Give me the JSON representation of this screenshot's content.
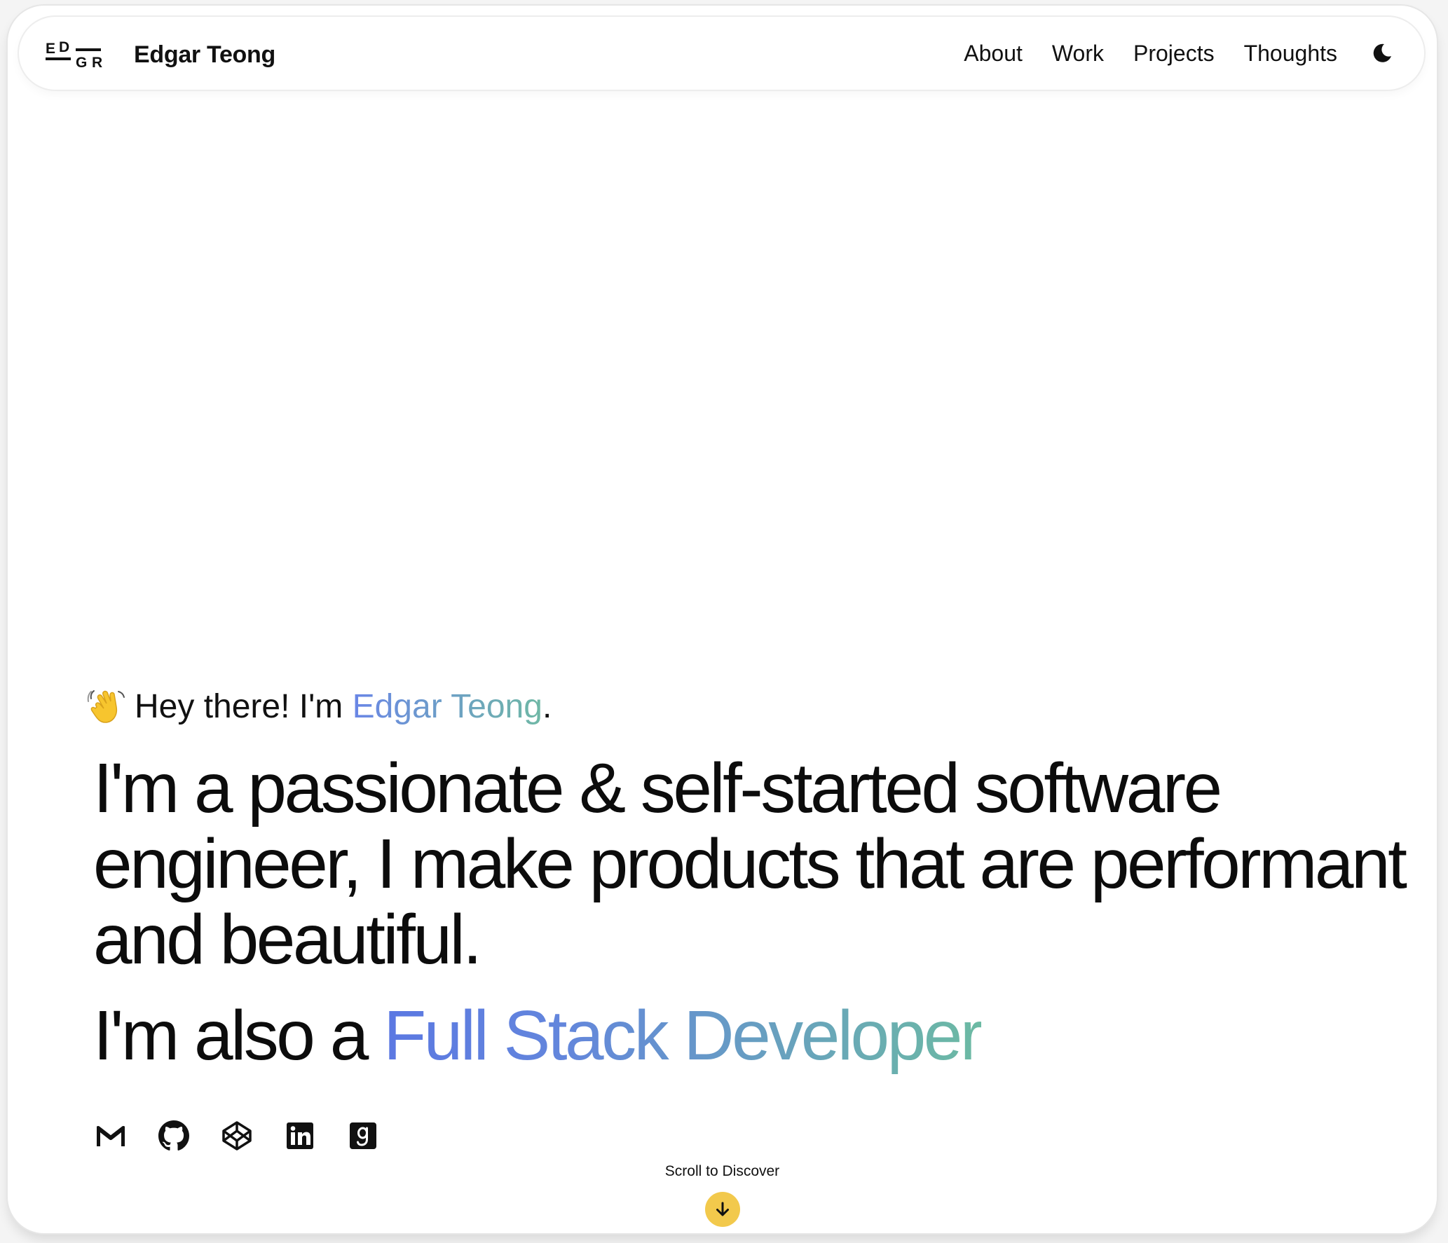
{
  "header": {
    "logo_text": "EDGR",
    "brand_name": "Edgar Teong",
    "nav": [
      {
        "label": "About"
      },
      {
        "label": "Work"
      },
      {
        "label": "Projects"
      },
      {
        "label": "Thoughts"
      }
    ],
    "theme_toggle_icon": "moon-icon"
  },
  "hero": {
    "wave_icon": "waving-hand-icon",
    "greeting_prefix": "Hey there! I'm ",
    "greeting_name": "Edgar Teong",
    "greeting_suffix": ".",
    "headline": "I'm a passionate & self-started software engineer, I make products that are performant and beautiful.",
    "also_prefix": "I'm also a ",
    "role": "Full Stack Developer"
  },
  "socials": [
    {
      "name": "gmail",
      "icon": "gmail-icon"
    },
    {
      "name": "github",
      "icon": "github-icon"
    },
    {
      "name": "codepen",
      "icon": "codepen-icon"
    },
    {
      "name": "linkedin",
      "icon": "linkedin-icon"
    },
    {
      "name": "goodreads",
      "icon": "goodreads-icon"
    }
  ],
  "scroll": {
    "label": "Scroll to Discover",
    "icon": "arrow-down-icon"
  },
  "colors": {
    "accent_start": "#5b78e2",
    "accent_end": "#6cbaa3",
    "scroll_button": "#f2c94c",
    "text": "#111111",
    "background": "#ffffff"
  }
}
